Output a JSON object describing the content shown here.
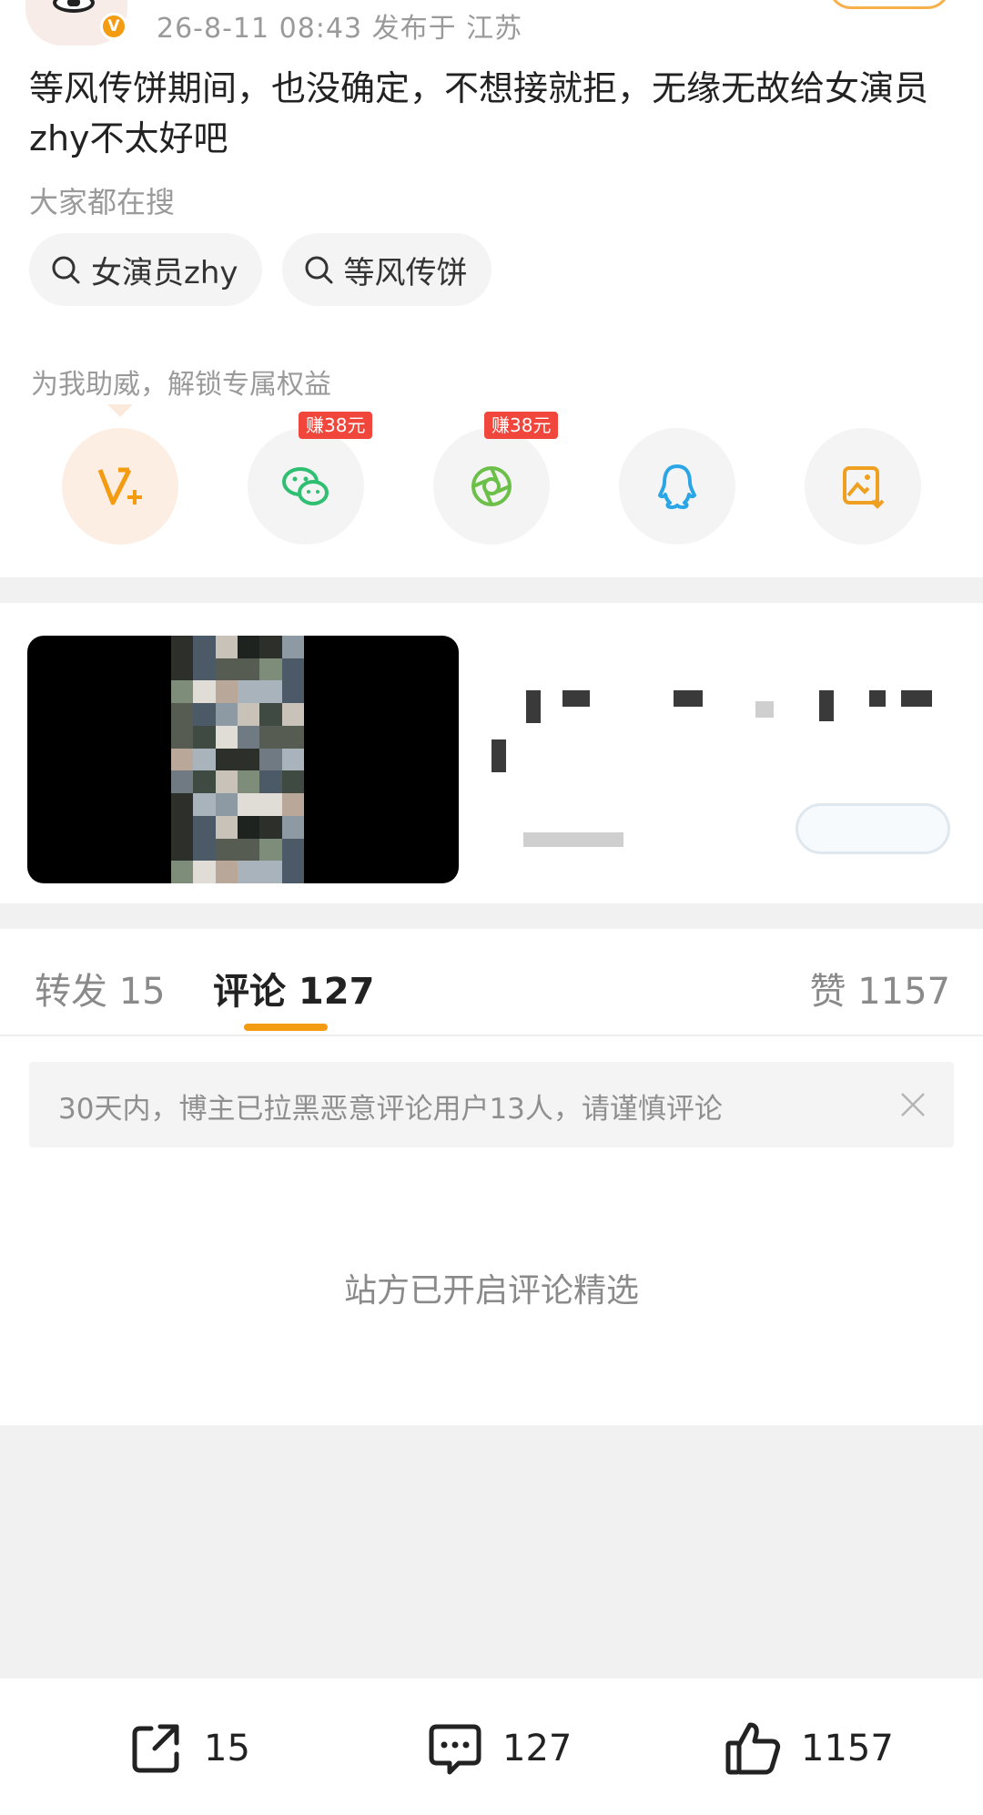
{
  "post": {
    "meta": "26-8-11 08:43  发布于 江苏",
    "text": "等风传饼期间，也没确定，不想接就拒，无缘无故给女演员zhy不太好吧",
    "verified_badge": "V"
  },
  "hot_search": {
    "label": "大家都在搜",
    "chips": [
      "女演员zhy",
      "等风传饼"
    ]
  },
  "support": {
    "label": "为我助威，解锁专属权益"
  },
  "share": {
    "items": [
      {
        "icon": "vip-plus-icon",
        "tag": ""
      },
      {
        "icon": "wechat-icon",
        "tag": "赚38元"
      },
      {
        "icon": "moments-icon",
        "tag": "赚38元"
      },
      {
        "icon": "qq-icon",
        "tag": ""
      },
      {
        "icon": "save-image-icon",
        "tag": ""
      }
    ]
  },
  "tabs": {
    "repost": "转发 15",
    "comment": "评论 127",
    "like": "赞 1157"
  },
  "notice": {
    "text": "30天内，博主已拉黑恶意评论用户13人，请谨慎评论"
  },
  "curated": {
    "text": "站方已开启评论精选"
  },
  "bottom_bar": {
    "repost_count": "15",
    "comment_count": "127",
    "like_count": "1157"
  },
  "colors": {
    "accent": "#f39c12",
    "earn_tag": "#f0463c",
    "wechat": "#2fbf71",
    "qq": "#2aa6e6"
  }
}
